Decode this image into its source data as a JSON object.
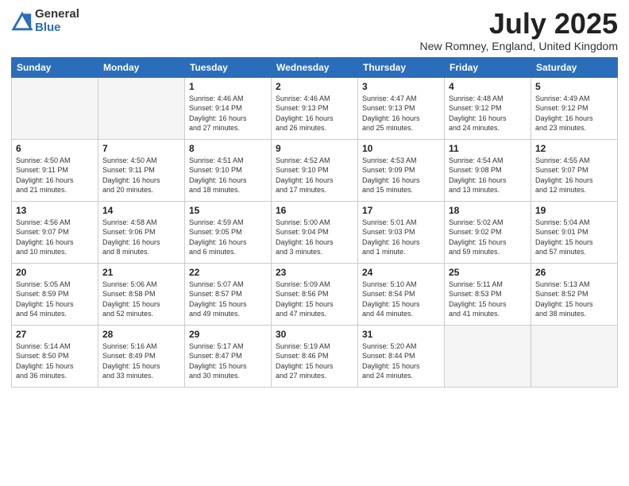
{
  "header": {
    "logo_general": "General",
    "logo_blue": "Blue",
    "month_title": "July 2025",
    "location": "New Romney, England, United Kingdom"
  },
  "weekdays": [
    "Sunday",
    "Monday",
    "Tuesday",
    "Wednesday",
    "Thursday",
    "Friday",
    "Saturday"
  ],
  "weeks": [
    [
      {
        "day": "",
        "info": ""
      },
      {
        "day": "",
        "info": ""
      },
      {
        "day": "1",
        "info": "Sunrise: 4:46 AM\nSunset: 9:14 PM\nDaylight: 16 hours\nand 27 minutes."
      },
      {
        "day": "2",
        "info": "Sunrise: 4:46 AM\nSunset: 9:13 PM\nDaylight: 16 hours\nand 26 minutes."
      },
      {
        "day": "3",
        "info": "Sunrise: 4:47 AM\nSunset: 9:13 PM\nDaylight: 16 hours\nand 25 minutes."
      },
      {
        "day": "4",
        "info": "Sunrise: 4:48 AM\nSunset: 9:12 PM\nDaylight: 16 hours\nand 24 minutes."
      },
      {
        "day": "5",
        "info": "Sunrise: 4:49 AM\nSunset: 9:12 PM\nDaylight: 16 hours\nand 23 minutes."
      }
    ],
    [
      {
        "day": "6",
        "info": "Sunrise: 4:50 AM\nSunset: 9:11 PM\nDaylight: 16 hours\nand 21 minutes."
      },
      {
        "day": "7",
        "info": "Sunrise: 4:50 AM\nSunset: 9:11 PM\nDaylight: 16 hours\nand 20 minutes."
      },
      {
        "day": "8",
        "info": "Sunrise: 4:51 AM\nSunset: 9:10 PM\nDaylight: 16 hours\nand 18 minutes."
      },
      {
        "day": "9",
        "info": "Sunrise: 4:52 AM\nSunset: 9:10 PM\nDaylight: 16 hours\nand 17 minutes."
      },
      {
        "day": "10",
        "info": "Sunrise: 4:53 AM\nSunset: 9:09 PM\nDaylight: 16 hours\nand 15 minutes."
      },
      {
        "day": "11",
        "info": "Sunrise: 4:54 AM\nSunset: 9:08 PM\nDaylight: 16 hours\nand 13 minutes."
      },
      {
        "day": "12",
        "info": "Sunrise: 4:55 AM\nSunset: 9:07 PM\nDaylight: 16 hours\nand 12 minutes."
      }
    ],
    [
      {
        "day": "13",
        "info": "Sunrise: 4:56 AM\nSunset: 9:07 PM\nDaylight: 16 hours\nand 10 minutes."
      },
      {
        "day": "14",
        "info": "Sunrise: 4:58 AM\nSunset: 9:06 PM\nDaylight: 16 hours\nand 8 minutes."
      },
      {
        "day": "15",
        "info": "Sunrise: 4:59 AM\nSunset: 9:05 PM\nDaylight: 16 hours\nand 6 minutes."
      },
      {
        "day": "16",
        "info": "Sunrise: 5:00 AM\nSunset: 9:04 PM\nDaylight: 16 hours\nand 3 minutes."
      },
      {
        "day": "17",
        "info": "Sunrise: 5:01 AM\nSunset: 9:03 PM\nDaylight: 16 hours\nand 1 minute."
      },
      {
        "day": "18",
        "info": "Sunrise: 5:02 AM\nSunset: 9:02 PM\nDaylight: 15 hours\nand 59 minutes."
      },
      {
        "day": "19",
        "info": "Sunrise: 5:04 AM\nSunset: 9:01 PM\nDaylight: 15 hours\nand 57 minutes."
      }
    ],
    [
      {
        "day": "20",
        "info": "Sunrise: 5:05 AM\nSunset: 8:59 PM\nDaylight: 15 hours\nand 54 minutes."
      },
      {
        "day": "21",
        "info": "Sunrise: 5:06 AM\nSunset: 8:58 PM\nDaylight: 15 hours\nand 52 minutes."
      },
      {
        "day": "22",
        "info": "Sunrise: 5:07 AM\nSunset: 8:57 PM\nDaylight: 15 hours\nand 49 minutes."
      },
      {
        "day": "23",
        "info": "Sunrise: 5:09 AM\nSunset: 8:56 PM\nDaylight: 15 hours\nand 47 minutes."
      },
      {
        "day": "24",
        "info": "Sunrise: 5:10 AM\nSunset: 8:54 PM\nDaylight: 15 hours\nand 44 minutes."
      },
      {
        "day": "25",
        "info": "Sunrise: 5:11 AM\nSunset: 8:53 PM\nDaylight: 15 hours\nand 41 minutes."
      },
      {
        "day": "26",
        "info": "Sunrise: 5:13 AM\nSunset: 8:52 PM\nDaylight: 15 hours\nand 38 minutes."
      }
    ],
    [
      {
        "day": "27",
        "info": "Sunrise: 5:14 AM\nSunset: 8:50 PM\nDaylight: 15 hours\nand 36 minutes."
      },
      {
        "day": "28",
        "info": "Sunrise: 5:16 AM\nSunset: 8:49 PM\nDaylight: 15 hours\nand 33 minutes."
      },
      {
        "day": "29",
        "info": "Sunrise: 5:17 AM\nSunset: 8:47 PM\nDaylight: 15 hours\nand 30 minutes."
      },
      {
        "day": "30",
        "info": "Sunrise: 5:19 AM\nSunset: 8:46 PM\nDaylight: 15 hours\nand 27 minutes."
      },
      {
        "day": "31",
        "info": "Sunrise: 5:20 AM\nSunset: 8:44 PM\nDaylight: 15 hours\nand 24 minutes."
      },
      {
        "day": "",
        "info": ""
      },
      {
        "day": "",
        "info": ""
      }
    ]
  ]
}
